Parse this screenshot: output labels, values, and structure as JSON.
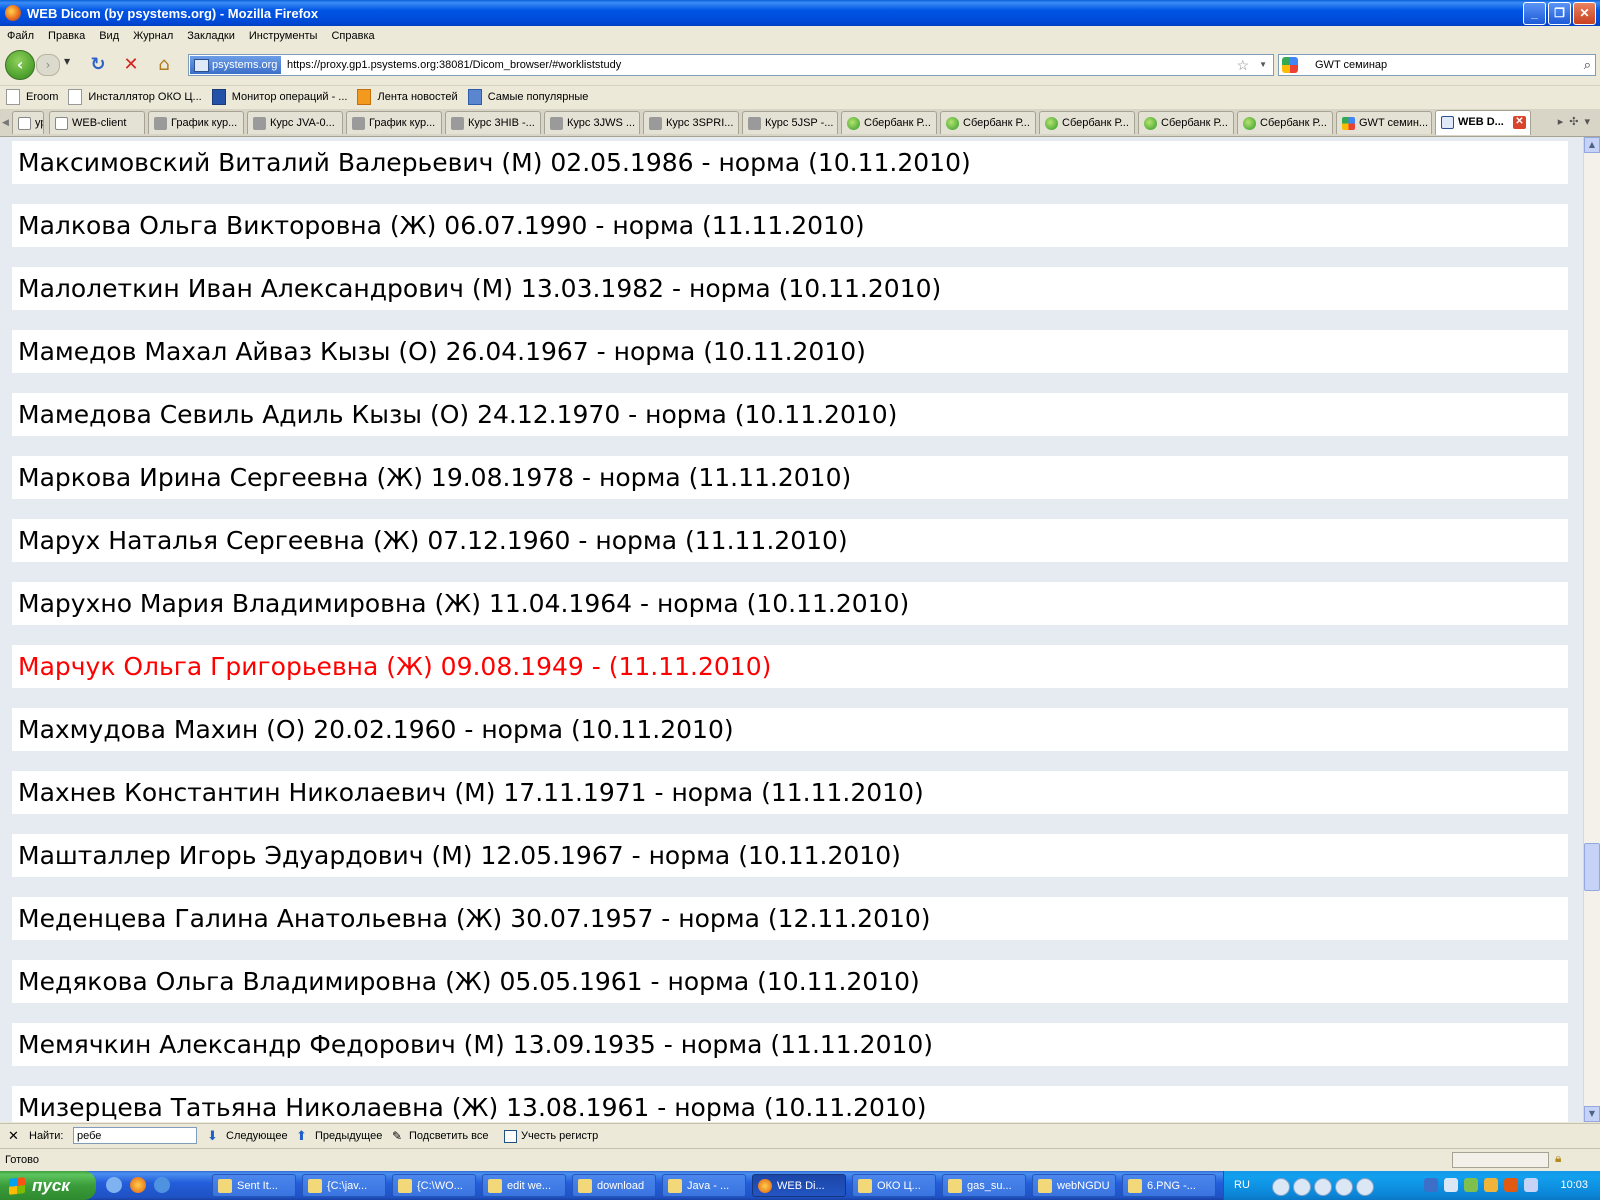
{
  "window": {
    "title": "WEB Dicom (by psystems.org) - Mozilla Firefox"
  },
  "menu": {
    "items": [
      "Файл",
      "Правка",
      "Вид",
      "Журнал",
      "Закладки",
      "Инструменты",
      "Справка"
    ]
  },
  "navigation": {
    "site_identity": "psystems.org",
    "url": "https://proxy.gp1.psystems.org:38081/Dicom_browser/#workliststudy",
    "search_value": "GWT семинар",
    "icons": [
      "back-arrow-icon",
      "forward-arrow-icon",
      "reload-icon",
      "stop-icon",
      "home-icon",
      "star-icon",
      "magnifier-icon"
    ]
  },
  "bookmarks": [
    {
      "label": "Eroom",
      "icon": "doc-icon"
    },
    {
      "label": "Инсталлятор ОКО Ц...",
      "icon": "doc-icon"
    },
    {
      "label": "Монитор операций - ...",
      "icon": "sap-icon"
    },
    {
      "label": "Лента новостей",
      "icon": "rss-icon"
    },
    {
      "label": "Самые популярные",
      "icon": "popular-icon"
    }
  ],
  "tabs": [
    {
      "label": "ур...",
      "icon": "page-icon"
    },
    {
      "label": "WEB-client",
      "icon": "page-icon"
    },
    {
      "label": "График кур...",
      "icon": "page-icon"
    },
    {
      "label": "Курс JVA-0...",
      "icon": "page-icon"
    },
    {
      "label": "График кур...",
      "icon": "page-icon"
    },
    {
      "label": "Курс 3HIB -...",
      "icon": "page-icon"
    },
    {
      "label": "Курс 3JWS ...",
      "icon": "page-icon"
    },
    {
      "label": "Курс 3SPRI...",
      "icon": "page-icon"
    },
    {
      "label": "Курс 5JSP -...",
      "icon": "page-icon"
    },
    {
      "label": "Сбербанк Р...",
      "icon": "sberbank-icon"
    },
    {
      "label": "Сбербанк Р...",
      "icon": "sberbank-icon"
    },
    {
      "label": "Сбербанк Р...",
      "icon": "sberbank-icon"
    },
    {
      "label": "Сбербанк Р...",
      "icon": "sberbank-icon"
    },
    {
      "label": "Сбербанк Р...",
      "icon": "sberbank-icon"
    },
    {
      "label": "GWT семин...",
      "icon": "google-icon"
    },
    {
      "label": "WEB D...",
      "icon": "web-dicom-icon",
      "active": true
    }
  ],
  "worklist": [
    {
      "text": "Максимовский Виталий Валерьевич (М) 02.05.1986 - норма (10.11.2010)",
      "highlight": false
    },
    {
      "text": "Малкова Ольга Викторовна (Ж) 06.07.1990 - норма (11.11.2010)",
      "highlight": false
    },
    {
      "text": "Малолеткин Иван Александрович (М) 13.03.1982 - норма (10.11.2010)",
      "highlight": false
    },
    {
      "text": "Мамедов Махал Айваз Кызы (О) 26.04.1967 - норма (10.11.2010)",
      "highlight": false
    },
    {
      "text": "Мамедова Севиль Адиль Кызы (О) 24.12.1970 - норма (10.11.2010)",
      "highlight": false
    },
    {
      "text": "Маркова Ирина Сергеевна (Ж) 19.08.1978 - норма (11.11.2010)",
      "highlight": false
    },
    {
      "text": "Марух Наталья Сергеевна (Ж) 07.12.1960 - норма (11.11.2010)",
      "highlight": false
    },
    {
      "text": "Марухно Мария Владимировна (Ж) 11.04.1964 - норма (10.11.2010)",
      "highlight": false
    },
    {
      "text": "Марчук Ольга Григорьевна (Ж) 09.08.1949 - (11.11.2010)",
      "highlight": true,
      "color": "#ff0000"
    },
    {
      "text": "Махмудова Махин (О) 20.02.1960 - норма (10.11.2010)",
      "highlight": false
    },
    {
      "text": "Махнев Константин Николаевич (М) 17.11.1971 - норма (11.11.2010)",
      "highlight": false
    },
    {
      "text": "Машталлер Игорь Эдуардович (М) 12.05.1967 - норма (10.11.2010)",
      "highlight": false
    },
    {
      "text": "Меденцева Галина Анатольевна (Ж) 30.07.1957 - норма (12.11.2010)",
      "highlight": false
    },
    {
      "text": "Медякова Ольга Владимировна (Ж) 05.05.1961 - норма (10.11.2010)",
      "highlight": false
    },
    {
      "text": "Мемячкин Александр Федорович (М) 13.09.1935 - норма (11.11.2010)",
      "highlight": false
    },
    {
      "text": "Мизерцева Татьяна Николаевна (Ж) 13.08.1961 - норма (10.11.2010)",
      "highlight": false
    }
  ],
  "findbar": {
    "label": "Найти:",
    "value": "ребе",
    "next": "Следующее",
    "previous": "Предыдущее",
    "highlight_all": "Подсветить все",
    "match_case": "Учесть регистр"
  },
  "status": {
    "text": "Готово"
  },
  "taskbar": {
    "start": "пуск",
    "tasks": [
      {
        "label": "Sent It...",
        "active": false
      },
      {
        "label": "{C:\\jav...",
        "active": false
      },
      {
        "label": "{C:\\WO...",
        "active": false
      },
      {
        "label": "edit we...",
        "active": false
      },
      {
        "label": "download",
        "active": false
      },
      {
        "label": "Java - ...",
        "active": false
      },
      {
        "label": "WEB Di...",
        "active": true
      },
      {
        "label": "ОКО Ц...",
        "active": false
      },
      {
        "label": "gas_su...",
        "active": false
      },
      {
        "label": "webNGDU",
        "active": false
      },
      {
        "label": "6.PNG -...",
        "active": false
      }
    ],
    "language": "RU",
    "clock": "10:03"
  },
  "colors": {
    "title_bar": "#0055e5",
    "content_bg": "#e6ebf2",
    "row_bg": "#ffffff",
    "highlight_text": "#ff0000",
    "taskbar": "#245edb",
    "start_button": "#3a9c3a"
  }
}
